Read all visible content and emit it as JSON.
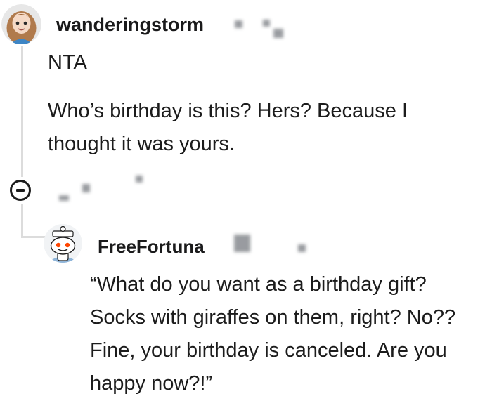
{
  "comments": [
    {
      "username": "wanderingstorm",
      "avatar_icon": "girl-avatar-icon",
      "paragraphs": [
        "NTA",
        "Who’s birthday is this? Hers? Because I thought it was yours."
      ]
    },
    {
      "username": "FreeFortuna",
      "avatar_icon": "snoo-avatar-icon",
      "paragraphs": [
        "“What do you want as a birthday gift? Socks with giraffes on them, right? No?? Fine, your birthday is canceled. Are you happy now?!”"
      ]
    }
  ],
  "collapse_icon": "collapse-thread-icon",
  "colors": {
    "text": "#1c1c1c",
    "thread_line": "#dcdcdc",
    "redaction": "#6e7278"
  }
}
